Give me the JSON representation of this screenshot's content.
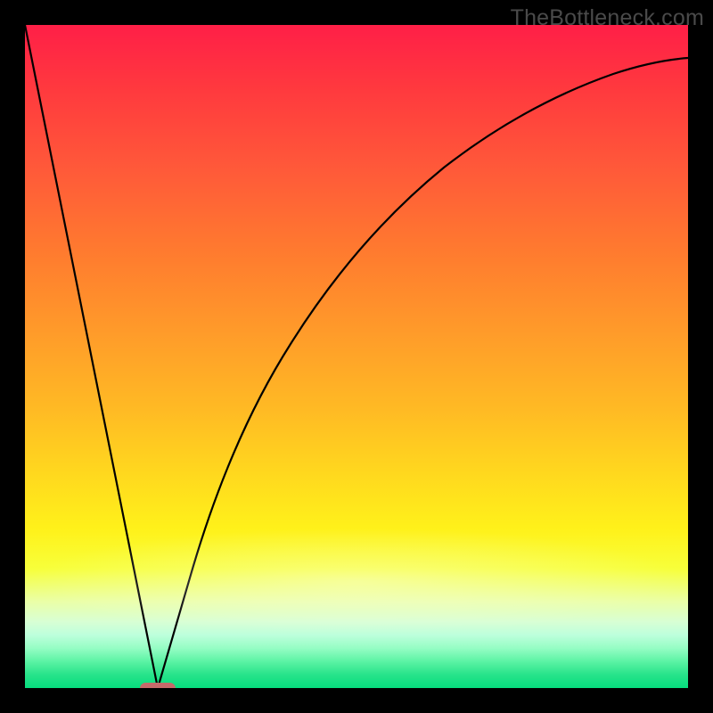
{
  "watermark": "TheBottleneck.com",
  "chart_data": {
    "type": "line",
    "title": "",
    "xlabel": "",
    "ylabel": "",
    "xlim": [
      0,
      1
    ],
    "ylim": [
      0,
      1
    ],
    "grid": false,
    "legend": false,
    "background_gradient": {
      "direction": "vertical",
      "stops": [
        {
          "pos": 0.0,
          "color": "#ff1f47"
        },
        {
          "pos": 0.5,
          "color": "#ffb224"
        },
        {
          "pos": 0.8,
          "color": "#fff11a"
        },
        {
          "pos": 1.0,
          "color": "#06dd7e"
        }
      ]
    },
    "series": [
      {
        "name": "left-branch",
        "x": [
          0.0,
          0.2
        ],
        "y": [
          1.0,
          0.0
        ]
      },
      {
        "name": "right-branch",
        "x": [
          0.2,
          0.25,
          0.3,
          0.35,
          0.4,
          0.45,
          0.5,
          0.55,
          0.6,
          0.65,
          0.7,
          0.75,
          0.8,
          0.85,
          0.9,
          0.95,
          1.0
        ],
        "y": [
          0.0,
          0.17,
          0.33,
          0.46,
          0.57,
          0.66,
          0.73,
          0.78,
          0.82,
          0.86,
          0.88,
          0.9,
          0.92,
          0.93,
          0.94,
          0.95,
          0.95
        ]
      }
    ],
    "marker": {
      "name": "bottleneck-indicator",
      "x": 0.2,
      "y": 0.0,
      "color": "#c66a6a"
    },
    "colors": {
      "curve": "#000000"
    }
  }
}
